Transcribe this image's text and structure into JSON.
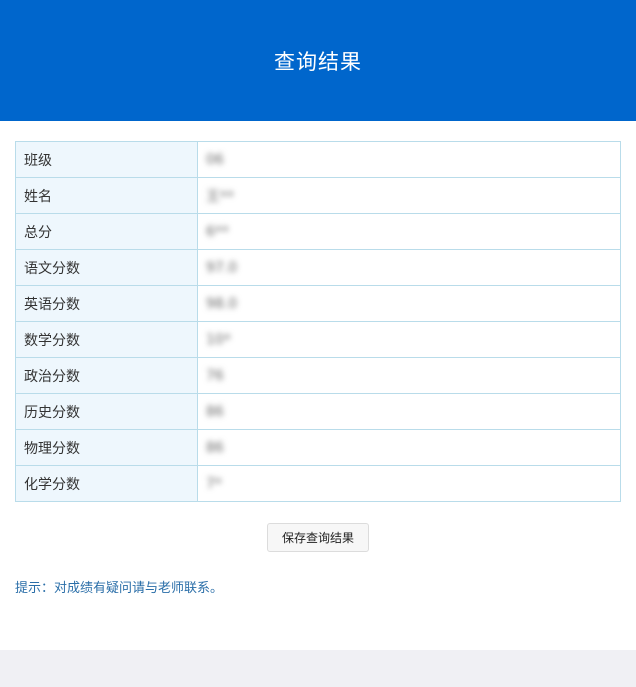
{
  "header": {
    "title": "查询结果"
  },
  "results": [
    {
      "label": "班级",
      "value": "06"
    },
    {
      "label": "姓名",
      "value": "王**"
    },
    {
      "label": "总分",
      "value": "6**"
    },
    {
      "label": "语文分数",
      "value": "97.0"
    },
    {
      "label": "英语分数",
      "value": "98.0"
    },
    {
      "label": "数学分数",
      "value": "10*"
    },
    {
      "label": "政治分数",
      "value": "76"
    },
    {
      "label": "历史分数",
      "value": "86"
    },
    {
      "label": "物理分数",
      "value": "86"
    },
    {
      "label": "化学分数",
      "value": "7*"
    }
  ],
  "actions": {
    "save_label": "保存查询结果"
  },
  "hint": {
    "text": "提示：对成绩有疑问请与老师联系。"
  },
  "colors": {
    "header_bg": "#0066cc",
    "label_bg": "#eef7fd",
    "border": "#b9dcea",
    "hint": "#2a6ea8"
  }
}
